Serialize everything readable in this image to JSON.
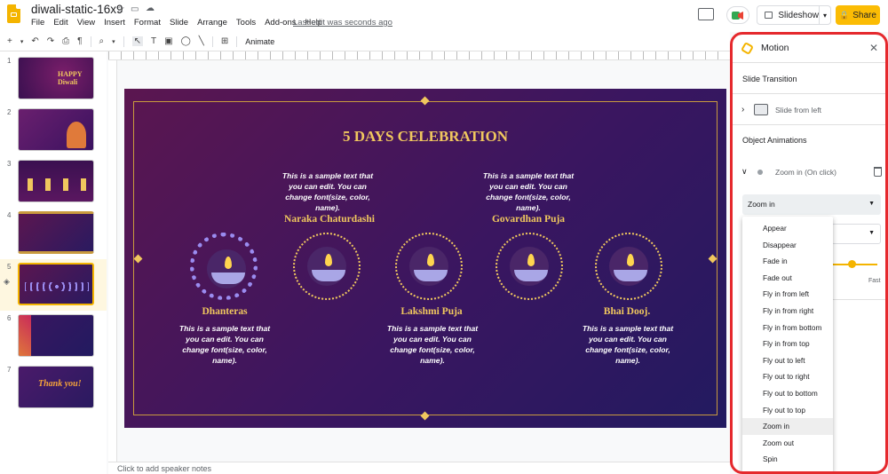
{
  "app": {
    "doc_title": "diwali-static-16x9",
    "menu": [
      "File",
      "Edit",
      "View",
      "Insert",
      "Format",
      "Slide",
      "Arrange",
      "Tools",
      "Add-ons",
      "Help"
    ],
    "last_edit": "Last edit was seconds ago",
    "slideshow_label": "Slideshow",
    "share_label": "Share"
  },
  "toolbar": {
    "animate_label": "Animate"
  },
  "filmstrip": {
    "slides": [
      {
        "num": "1",
        "text": "HAPPY Diwali"
      },
      {
        "num": "2",
        "text": ""
      },
      {
        "num": "3",
        "text": ""
      },
      {
        "num": "4",
        "text": ""
      },
      {
        "num": "5",
        "text": ""
      },
      {
        "num": "6",
        "text": ""
      },
      {
        "num": "7",
        "text": "Thank you!"
      }
    ],
    "selected_slide": "5"
  },
  "slide": {
    "title": "5 DAYS CELEBRATION",
    "items": [
      {
        "name": "Dhanteras",
        "desc": "This is a sample text that you can edit. You can change font(size, color, name)."
      },
      {
        "name": "Naraka Chaturdashi",
        "desc": "This is a sample text that you can edit. You can change font(size, color, name)."
      },
      {
        "name": "Lakshmi Puja",
        "desc": "This is a sample text that you can edit. You can change font(size, color, name)."
      },
      {
        "name": "Govardhan Puja",
        "desc": "This is a sample text that you can edit. You can change font(size, color, name)."
      },
      {
        "name": "Bhai Dooj.",
        "desc": "This is a sample text that you can edit. You can change font(size, color, name)."
      }
    ],
    "speaker_notes_placeholder": "Click to add speaker notes"
  },
  "motion_panel": {
    "title": "Motion",
    "slide_transition_heading": "Slide Transition",
    "transition_value": "Slide from left",
    "object_animations_heading": "Object Animations",
    "animation_summary": "Zoom in  (On click)",
    "animation_type": "Zoom in",
    "speed_label_fast": "Fast",
    "speed_fraction": 0.4,
    "dropdown_options": [
      "Appear",
      "Disappear",
      "Fade in",
      "Fade out",
      "Fly in from left",
      "Fly in from right",
      "Fly in from bottom",
      "Fly in from top",
      "Fly out to left",
      "Fly out to right",
      "Fly out to bottom",
      "Fly out to top",
      "Zoom in",
      "Zoom out",
      "Spin"
    ],
    "highlighted_option": "Zoom in",
    "accent_color": "#e5292d"
  }
}
